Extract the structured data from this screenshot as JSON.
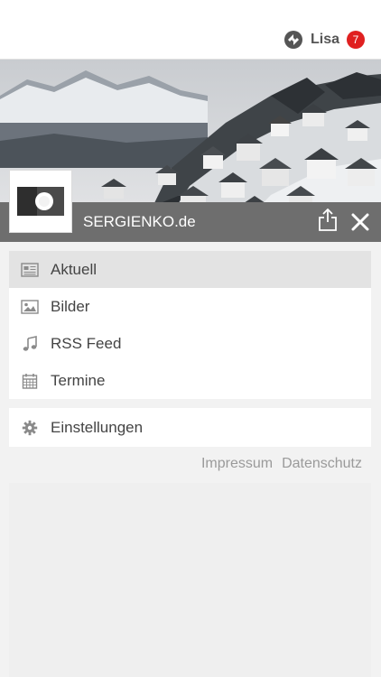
{
  "header": {
    "user_name": "Lisa",
    "notification_count": "7",
    "logo_icon": "app-logo-icon"
  },
  "site": {
    "title": "SERGIENKO.de"
  },
  "menu": {
    "items": [
      {
        "label": "Aktuell",
        "icon": "newspaper-icon",
        "active": true
      },
      {
        "label": "Bilder",
        "icon": "image-icon",
        "active": false
      },
      {
        "label": "RSS Feed",
        "icon": "music-note-icon",
        "active": false
      },
      {
        "label": "Termine",
        "icon": "calendar-icon",
        "active": false
      }
    ],
    "settings_label": "Einstellungen"
  },
  "footer": {
    "impressum": "Impressum",
    "datenschutz": "Datenschutz"
  },
  "colors": {
    "badge": "#e02020",
    "title_bar": "#6e6e6e",
    "active_item": "#e3e3e3"
  }
}
